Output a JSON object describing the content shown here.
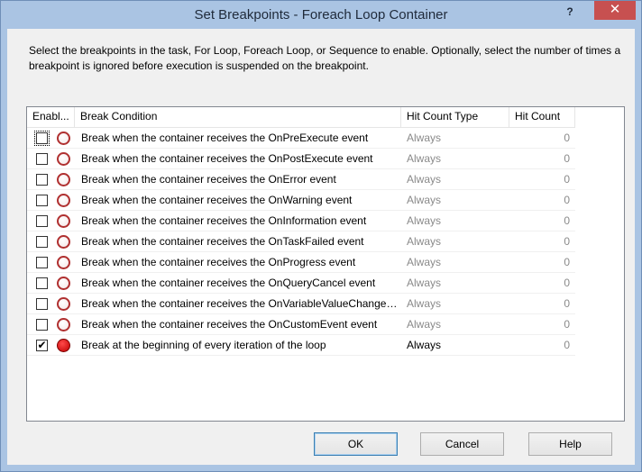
{
  "window": {
    "title": "Set Breakpoints - Foreach Loop Container",
    "help_glyph": "?",
    "close_glyph": "✕"
  },
  "description": "Select the breakpoints in the task, For Loop, Foreach Loop, or Sequence to enable. Optionally, select the number of times a breakpoint is ignored before execution is suspended on the breakpoint.",
  "grid": {
    "columns": {
      "enabled": "Enabl...",
      "condition": "Break Condition",
      "hit_type": "Hit Count Type",
      "hit_count": "Hit Count"
    },
    "rows": [
      {
        "checked": false,
        "condition": "Break when the container receives the OnPreExecute event",
        "hit_type": "Always",
        "hit_count": "0"
      },
      {
        "checked": false,
        "condition": "Break when the container receives the OnPostExecute event",
        "hit_type": "Always",
        "hit_count": "0"
      },
      {
        "checked": false,
        "condition": "Break when the container receives the OnError event",
        "hit_type": "Always",
        "hit_count": "0"
      },
      {
        "checked": false,
        "condition": "Break when the container receives the OnWarning event",
        "hit_type": "Always",
        "hit_count": "0"
      },
      {
        "checked": false,
        "condition": "Break when the container receives the OnInformation event",
        "hit_type": "Always",
        "hit_count": "0"
      },
      {
        "checked": false,
        "condition": "Break when the container receives the OnTaskFailed event",
        "hit_type": "Always",
        "hit_count": "0"
      },
      {
        "checked": false,
        "condition": "Break when the container receives the OnProgress event",
        "hit_type": "Always",
        "hit_count": "0"
      },
      {
        "checked": false,
        "condition": "Break when the container receives the OnQueryCancel event",
        "hit_type": "Always",
        "hit_count": "0"
      },
      {
        "checked": false,
        "condition": "Break when the container receives the OnVariableValueChanged...",
        "hit_type": "Always",
        "hit_count": "0"
      },
      {
        "checked": false,
        "condition": "Break when the container receives the OnCustomEvent event",
        "hit_type": "Always",
        "hit_count": "0"
      },
      {
        "checked": true,
        "condition": "Break at the beginning of every iteration of the loop",
        "hit_type": "Always",
        "hit_count": "0"
      }
    ]
  },
  "buttons": {
    "ok": "OK",
    "cancel": "Cancel",
    "help": "Help"
  },
  "colors": {
    "title_bar": "#aac4e3",
    "close_button": "#c75050",
    "breakpoint_enabled": "#c00000"
  },
  "check_glyph": "✔"
}
